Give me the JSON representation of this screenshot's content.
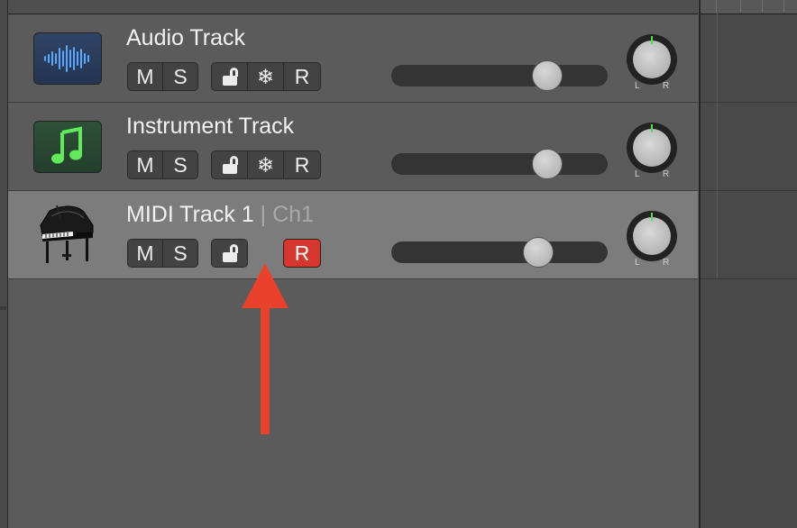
{
  "tracks": [
    {
      "name": "Audio Track",
      "icon": "waveform-icon",
      "mute": "M",
      "solo": "S",
      "record": "R",
      "lock": "lock-icon",
      "freeze": "❄",
      "volume": 0.72,
      "pan": 0,
      "pan_left": "L",
      "pan_right": "R",
      "selected": false,
      "record_armed": false
    },
    {
      "name": "Instrument Track",
      "icon": "music-note-icon",
      "mute": "M",
      "solo": "S",
      "record": "R",
      "lock": "lock-icon",
      "freeze": "❄",
      "volume": 0.72,
      "pan": 0,
      "pan_left": "L",
      "pan_right": "R",
      "selected": false,
      "record_armed": false
    },
    {
      "name": "MIDI Track 1",
      "separator": "|",
      "channel": "Ch1",
      "icon": "grand-piano-icon",
      "mute": "M",
      "solo": "S",
      "record": "R",
      "lock": "lock-icon",
      "volume": 0.68,
      "pan": 0,
      "pan_left": "L",
      "pan_right": "R",
      "selected": true,
      "record_armed": true
    }
  ],
  "annotation": {
    "icon": "red-arrow-icon",
    "color": "#e8412c"
  },
  "colors": {
    "record_armed": "#d5372f",
    "meter_green": "#51e04a",
    "selected_row": "#7c7c7c"
  }
}
